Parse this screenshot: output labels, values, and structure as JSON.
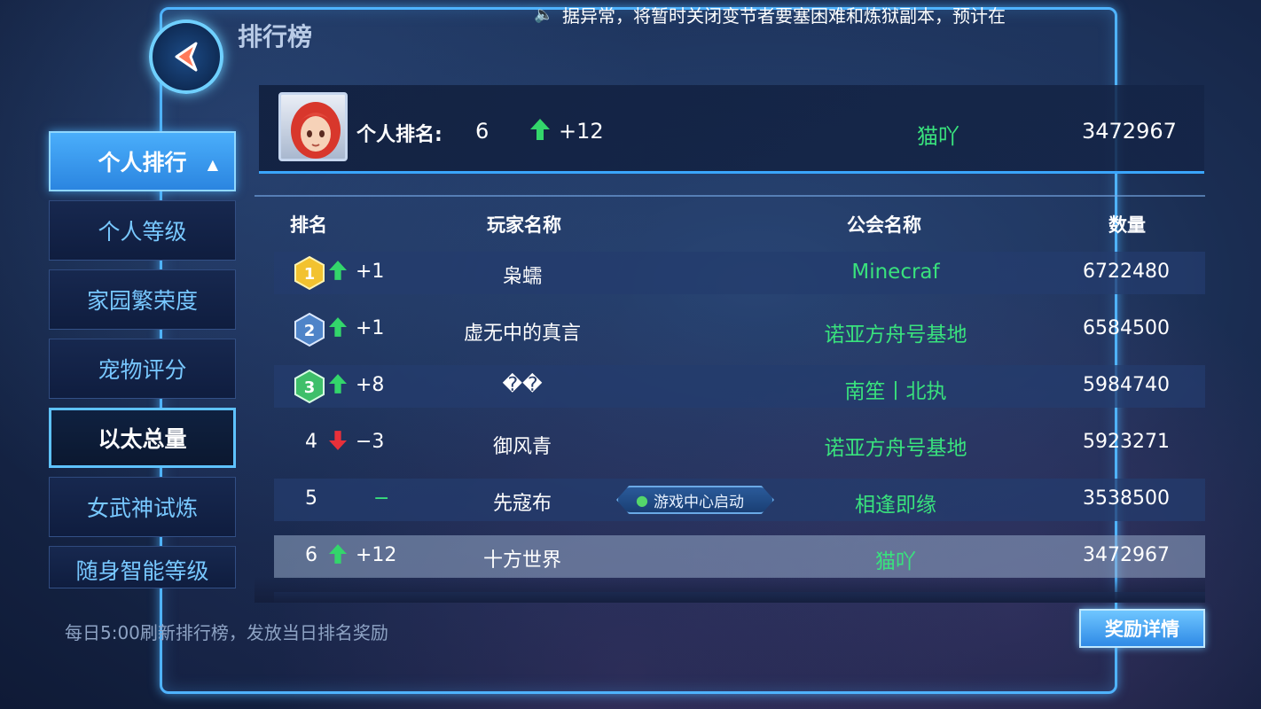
{
  "header": {
    "title": "排行榜",
    "marquee": "据异常，将暂时关闭变节者要塞困难和炼狱副本，预计在"
  },
  "sidebar": {
    "items": [
      {
        "label": "个人排行"
      },
      {
        "label": "个人等级"
      },
      {
        "label": "家园繁荣度"
      },
      {
        "label": "宠物评分"
      },
      {
        "label": "以太总量"
      },
      {
        "label": "女武神试炼"
      },
      {
        "label": "随身智能等级"
      }
    ]
  },
  "me": {
    "label": "个人排名:",
    "rank": "6",
    "change": "+12",
    "guild": "猫吖",
    "score": "3472967"
  },
  "table": {
    "headers": {
      "rank": "排名",
      "player": "玩家名称",
      "guild": "公会名称",
      "score": "数量"
    },
    "rows": [
      {
        "rank": "1",
        "change": "+1",
        "player": "枭蠕",
        "guild": "Minecraf",
        "score": "6722480"
      },
      {
        "rank": "2",
        "change": "+1",
        "player": "虚无中的真言",
        "guild": "诺亚方舟号基地",
        "score": "6584500"
      },
      {
        "rank": "3",
        "change": "+8",
        "player": "��",
        "guild": "南笙丨北执",
        "score": "5984740"
      },
      {
        "rank": "4",
        "change": "−3",
        "player": "御风青",
        "guild": "诺亚方舟号基地",
        "score": "5923271"
      },
      {
        "rank": "5",
        "change": "−",
        "player": "先寇布",
        "guild": "相逢即缘",
        "score": "3538500",
        "badge": "游戏中心启动"
      },
      {
        "rank": "6",
        "change": "+12",
        "player": "十方世界",
        "guild": "猫吖",
        "score": "3472967"
      }
    ]
  },
  "footer": {
    "note": "每日5:00刷新排行榜，发放当日排名奖励",
    "reward_button": "奖励详情"
  },
  "colors": {
    "accent": "#4fb3ff",
    "guild_green": "#39e27d",
    "up_arrow": "#33d66b",
    "down_arrow": "#e8303a"
  }
}
